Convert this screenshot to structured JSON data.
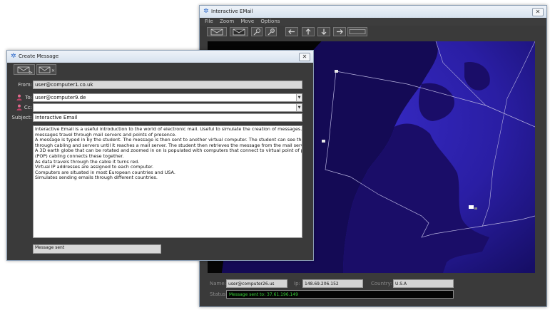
{
  "main_window": {
    "title": "Interactive EMail",
    "menu": [
      "File",
      "Zoom",
      "Move",
      "Options"
    ],
    "toolbar": [
      "compose-mail-icon",
      "mail-icon",
      "search-icon",
      "zoom-icon",
      "arrow-left-icon",
      "arrow-up-icon",
      "arrow-down-icon",
      "arrow-right-icon",
      "blank-button"
    ],
    "info": {
      "name_label": "Name:",
      "name_value": "user@computer26.us",
      "ip_label": "Ip:",
      "ip_value": "148.69.206.152",
      "country_label": "Country:",
      "country_value": "U.S.A",
      "status_label": "Status:",
      "status_value": "Message sent to: 37.61.196.149"
    }
  },
  "create_window": {
    "title": "Create Message",
    "toolbar": [
      "send-mail-icon",
      "delete-mail-icon"
    ],
    "from_label": "From:",
    "from_value": "user@computer1.co.uk",
    "to_label": "To:",
    "to_value": "user@computer9.de",
    "cc_label": "Cc:",
    "cc_value": "",
    "subject_label": "Subject:",
    "subject_value": "Interactive Email",
    "body_lines": [
      "Interactive Email is a useful introduction to the world of electronic mail. Useful to simulate the creation of messages. Watch as",
      "messages travel through mail servers and points of presence.",
      "A message is typed in by the student. The message is then sent to another virtual computer. The student can see the email travel",
      "through cabling and servers until it reaches a mail server. The student then retrieves the message from the mail server.",
      "A 3D earth globe that can be rotated and zoomed in on is populated with computers that connect to virtual point of presence",
      "(POP) cabling connects these together.",
      "As data travels through the cable it turns red.",
      "Virtual IP addresses are assigned to each computer.",
      "Computers are situated in most European countries and USA.",
      "Simulates sending emails through different countries."
    ],
    "status_value": "Message sent"
  },
  "colors": {
    "window_bg": "#3a3a3a",
    "globe_ocean": "#2b1fa8",
    "globe_land": "#140a55",
    "status_text": "#37d337"
  }
}
